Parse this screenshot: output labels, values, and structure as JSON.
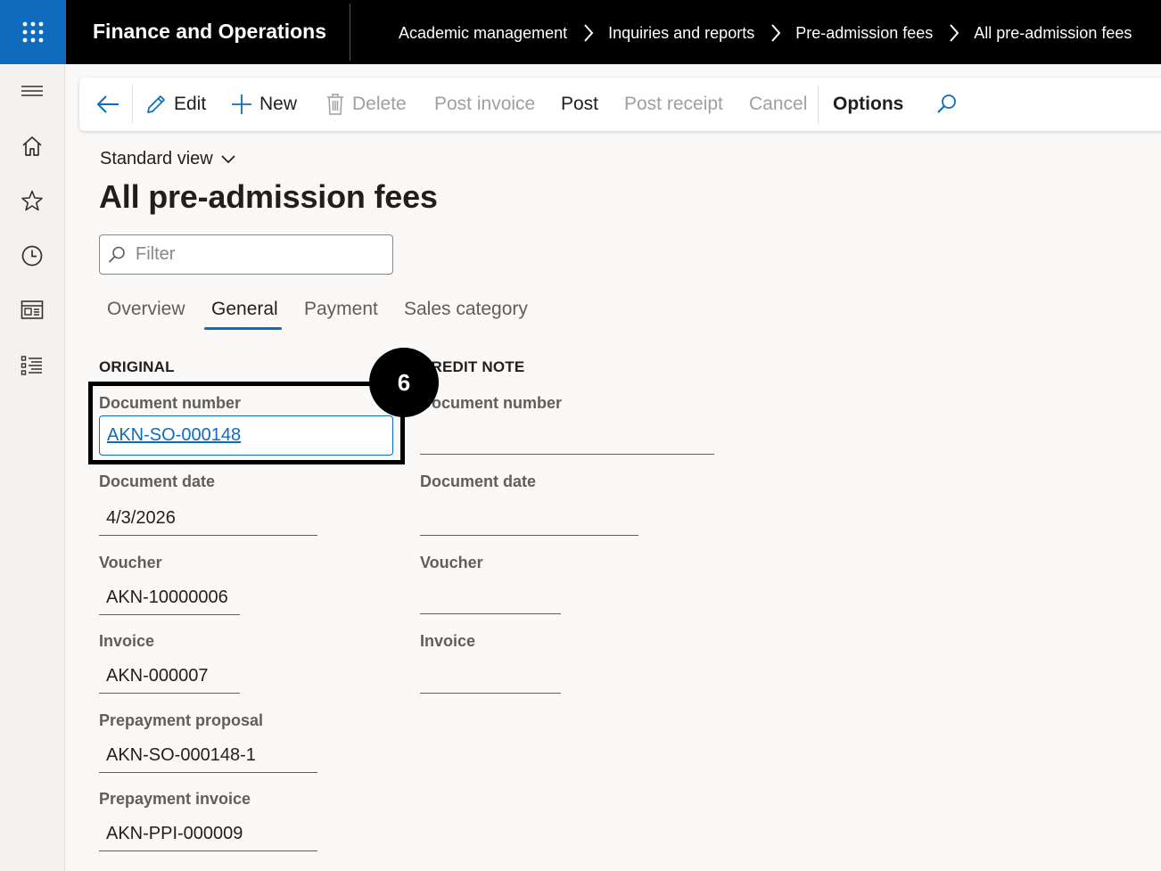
{
  "app": {
    "title": "Finance and Operations",
    "launcher_icon": "waffle-icon"
  },
  "breadcrumbs": [
    "Academic management",
    "Inquiries and reports",
    "Pre-admission fees",
    "All pre-admission fees"
  ],
  "rail": [
    "menu-icon",
    "home-icon",
    "star-icon",
    "clock-icon",
    "workspace-icon",
    "list-icon"
  ],
  "toolbar": {
    "edit": "Edit",
    "new": "New",
    "delete": "Delete",
    "post_invoice": "Post invoice",
    "post": "Post",
    "post_receipt": "Post receipt",
    "cancel": "Cancel",
    "options": "Options"
  },
  "view": {
    "selector": "Standard view",
    "title": "All pre-admission fees"
  },
  "filter": {
    "placeholder": "Filter"
  },
  "tabs": {
    "overview": "Overview",
    "general": "General",
    "payment": "Payment",
    "sales_category": "Sales category",
    "active": "General"
  },
  "original": {
    "heading": "ORIGINAL",
    "document_number_label": "Document number",
    "document_number": "AKN-SO-000148",
    "document_date_label": "Document date",
    "document_date": "4/3/2026",
    "voucher_label": "Voucher",
    "voucher": "AKN-10000006",
    "invoice_label": "Invoice",
    "invoice": "AKN-000007",
    "prepayment_proposal_label": "Prepayment proposal",
    "prepayment_proposal": "AKN-SO-000148-1",
    "prepayment_invoice_label": "Prepayment invoice",
    "prepayment_invoice": "AKN-PPI-000009"
  },
  "credit_note": {
    "heading": "CREDIT NOTE",
    "document_number_label": "Document number",
    "document_date_label": "Document date",
    "voucher_label": "Voucher",
    "invoice_label": "Invoice"
  },
  "callout": {
    "number": "6"
  },
  "colors": {
    "accent": "#0f6cbd",
    "topbar": "#000000",
    "background": "#faf9f8"
  }
}
